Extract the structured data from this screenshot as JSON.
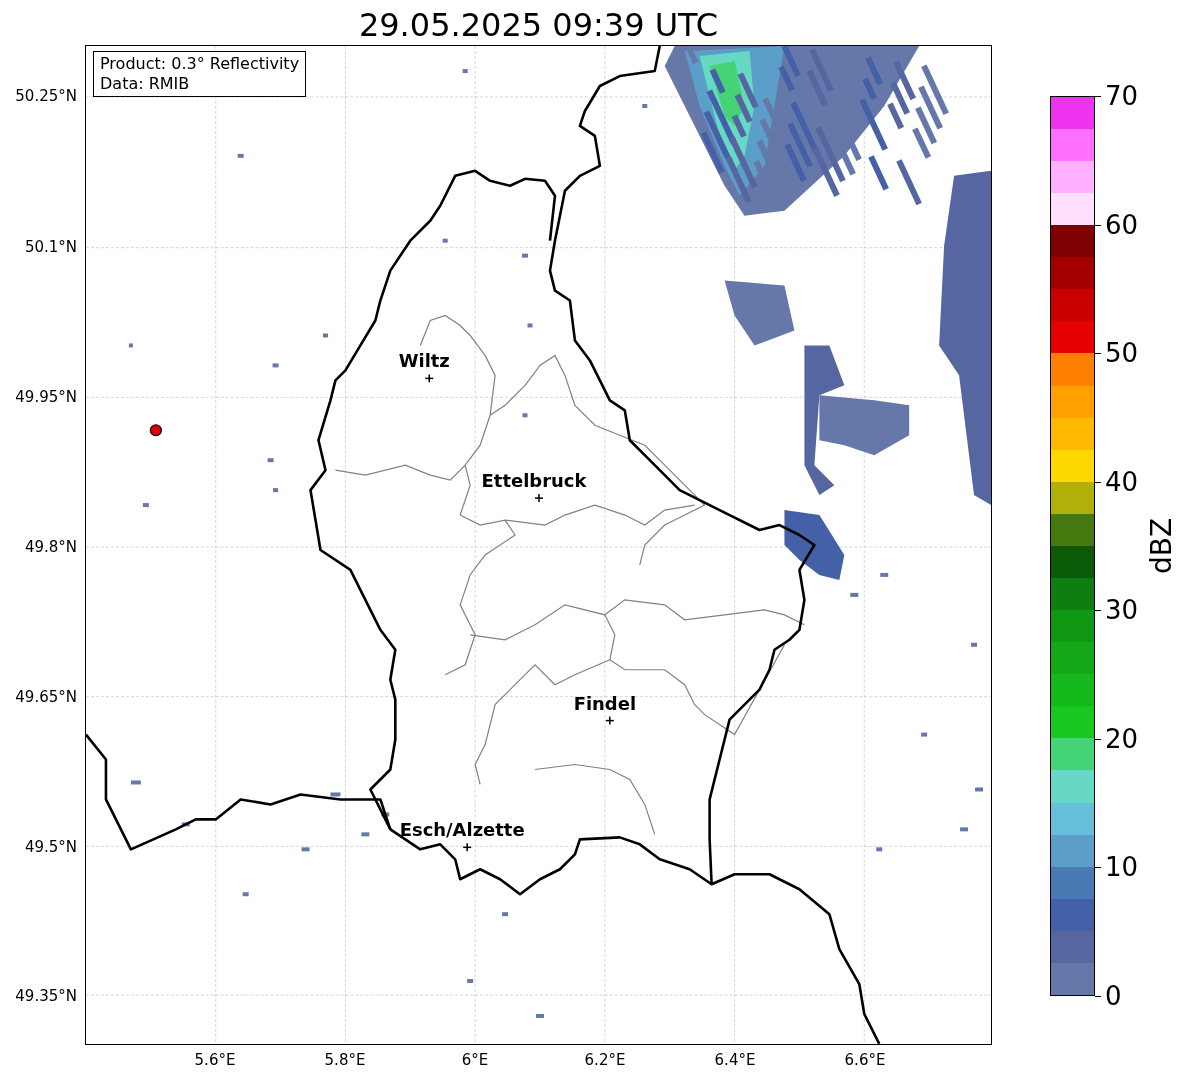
{
  "title": "29.05.2025 09:39 UTC",
  "info_box": {
    "lines": [
      "Product: 0.3° Reflectivity",
      "Data: RMIB"
    ]
  },
  "map": {
    "cities": [
      {
        "name": "Wiltz"
      },
      {
        "name": "Ettelbruck"
      },
      {
        "name": "Findel"
      },
      {
        "name": "Esch/Alzette"
      }
    ],
    "x_ticks": [
      "5.6°E",
      "5.8°E",
      "6°E",
      "6.2°E",
      "6.4°E",
      "6.6°E"
    ],
    "y_ticks": [
      "50.25°N",
      "50.1°N",
      "49.95°N",
      "49.8°N",
      "49.65°N",
      "49.5°N",
      "49.35°N"
    ]
  },
  "colorbar": {
    "label": "dBZ",
    "ticks": [
      "70",
      "60",
      "50",
      "40",
      "30",
      "20",
      "10",
      "0"
    ],
    "segments": [
      {
        "color": "#6677aa"
      },
      {
        "color": "#5566a0"
      },
      {
        "color": "#4460a6"
      },
      {
        "color": "#4a7ab4"
      },
      {
        "color": "#5b9ec8"
      },
      {
        "color": "#66c0dc"
      },
      {
        "color": "#66d8c4"
      },
      {
        "color": "#44d476"
      },
      {
        "color": "#18c81e"
      },
      {
        "color": "#14b81a"
      },
      {
        "color": "#14a816"
      },
      {
        "color": "#109814"
      },
      {
        "color": "#0e7e12"
      },
      {
        "color": "#0a5a08"
      },
      {
        "color": "#467810"
      },
      {
        "color": "#b0b008"
      },
      {
        "color": "#ffd800"
      },
      {
        "color": "#ffba00"
      },
      {
        "color": "#ffa000"
      },
      {
        "color": "#ff8000"
      },
      {
        "color": "#e60000"
      },
      {
        "color": "#c80000"
      },
      {
        "color": "#a40000"
      },
      {
        "color": "#7e0000"
      },
      {
        "color": "#ffe0ff"
      },
      {
        "color": "#ffb0ff"
      },
      {
        "color": "#ff70ff"
      },
      {
        "color": "#ee33ee"
      }
    ]
  }
}
